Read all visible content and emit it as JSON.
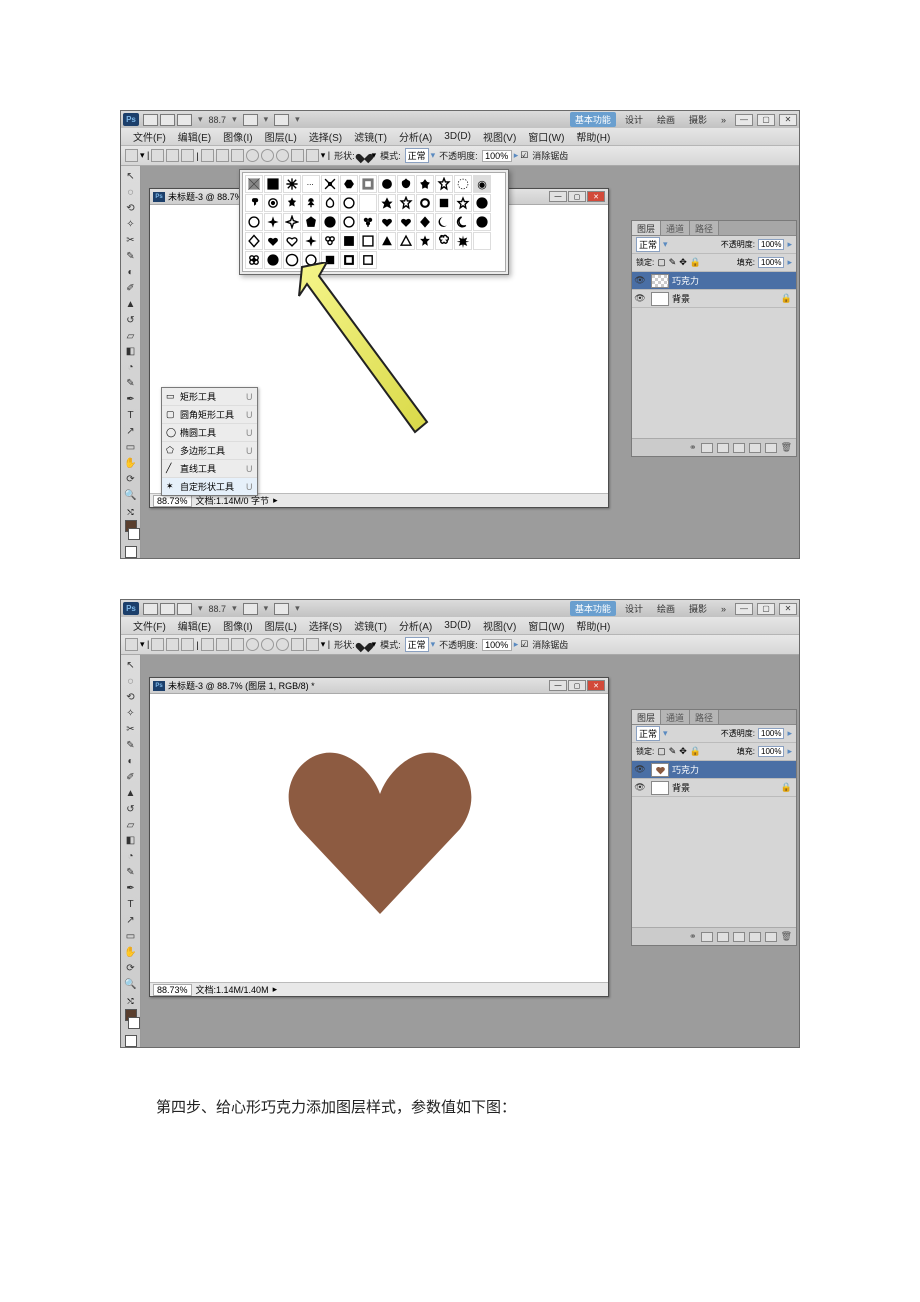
{
  "app": {
    "logo": "Ps"
  },
  "titlebar": {
    "zoom": "88.7",
    "right": {
      "workspace_active": "基本功能",
      "items": [
        "设计",
        "绘画",
        "摄影"
      ],
      "expand": "»"
    }
  },
  "menubar": {
    "items": [
      "文件(F)",
      "编辑(E)",
      "图像(I)",
      "图层(L)",
      "选择(S)",
      "滤镜(T)",
      "分析(A)",
      "3D(D)",
      "视图(V)",
      "窗口(W)",
      "帮助(H)"
    ]
  },
  "options": {
    "shape_lbl": "形状:",
    "mode_lbl": "模式:",
    "mode_val": "正常",
    "opacity_lbl": "不透明度:",
    "opacity_val": "100%",
    "antialias": "消除锯齿"
  },
  "doc1": {
    "title": "未标题-3 @ 88.7%",
    "status": {
      "left": "88.73%",
      "mid": "文档:1.14M/0 字节"
    }
  },
  "doc2": {
    "title": "未标题-3 @ 88.7% (图层 1, RGB/8) *",
    "status": {
      "left": "88.73%",
      "mid": "文档:1.14M/1.40M"
    }
  },
  "layers_panel": {
    "tabs": [
      "图层",
      "通道",
      "路径"
    ],
    "blend": "正常",
    "opacity_lbl": "不透明度:",
    "opacity_val": "100%",
    "lock_lbl": "锁定:",
    "fill_lbl": "填充:",
    "fill_val": "100%",
    "layer_choco": "巧克力",
    "layer_bg": "背景"
  },
  "tool_flyout": {
    "rows": [
      {
        "icon": "▭",
        "label": "矩形工具",
        "key": "U"
      },
      {
        "icon": "▢",
        "label": "圆角矩形工具",
        "key": "U"
      },
      {
        "icon": "◯",
        "label": "椭圆工具",
        "key": "U"
      },
      {
        "icon": "⬠",
        "label": "多边形工具",
        "key": "U"
      },
      {
        "icon": "╱",
        "label": "直线工具",
        "key": "U"
      },
      {
        "icon": "✶",
        "label": "自定形状工具",
        "key": "U"
      }
    ]
  },
  "heart_color": "#8d5b41",
  "caption": "第四步、给心形巧克力添加图层样式，参数值如下图："
}
